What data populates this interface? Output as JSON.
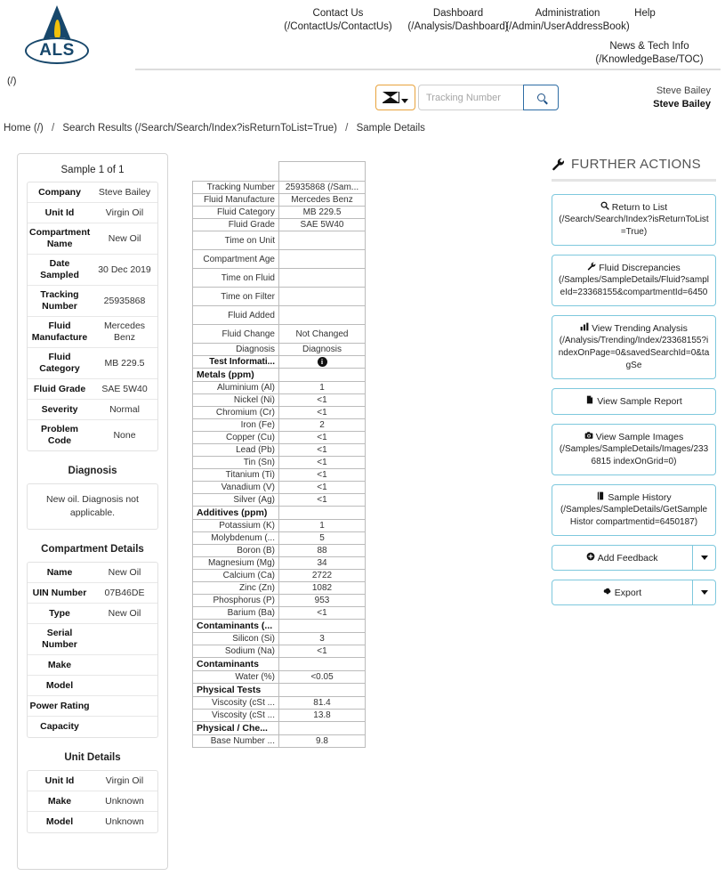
{
  "header": {
    "logo_text": "ALS",
    "nav": [
      {
        "label": "Contact Us",
        "url": "(/ContactUs/ContactUs)"
      },
      {
        "label": "Dashboard",
        "url": "(/Analysis/Dashboard)"
      },
      {
        "label": "Administration",
        "url": "(/Admin/UserAddressBook)"
      },
      {
        "label": "Help",
        "url": ""
      },
      {
        "label": "News & Tech Info",
        "url": "(/KnowledgeBase/TOC)"
      }
    ],
    "home_path": "(/)",
    "search": {
      "placeholder": "Tracking Number",
      "value": "",
      "env_icon": "envelope-icon",
      "search_icon": "search-icon"
    },
    "user": {
      "line1": "Steve Bailey",
      "line2": "Steve Bailey"
    }
  },
  "breadcrumb": {
    "items": [
      "Home (/)",
      "Search Results (/Search/Search/Index?isReturnToList=True)",
      "Sample Details"
    ],
    "separator": "/"
  },
  "left_panel": {
    "sample_count": "Sample 1 of 1",
    "summary_rows": [
      {
        "key": "Company",
        "value": "Steve Bailey"
      },
      {
        "key": "Unit Id",
        "value": "Virgin Oil"
      },
      {
        "key": "Compartment Name",
        "value": "New Oil"
      },
      {
        "key": "Date Sampled",
        "value": "30 Dec 2019"
      },
      {
        "key": "Tracking Number",
        "value": "25935868"
      },
      {
        "key": "Fluid Manufacture",
        "value": "Mercedes Benz"
      },
      {
        "key": "Fluid Category",
        "value": "MB 229.5"
      },
      {
        "key": "Fluid Grade",
        "value": "SAE 5W40"
      },
      {
        "key": "Severity",
        "value": "Normal"
      },
      {
        "key": "Problem Code",
        "value": "None"
      }
    ],
    "diagnosis_title": "Diagnosis",
    "diagnosis_text": "New oil. Diagnosis not applicable.",
    "compartment_title": "Compartment Details",
    "compartment_rows": [
      {
        "key": "Name",
        "value": "New Oil"
      },
      {
        "key": "UIN Number",
        "value": "07B46DE"
      },
      {
        "key": "Type",
        "value": "New Oil"
      },
      {
        "key": "Serial Number",
        "value": ""
      },
      {
        "key": "Make",
        "value": ""
      },
      {
        "key": "Model",
        "value": ""
      },
      {
        "key": "Power Rating",
        "value": ""
      },
      {
        "key": "Capacity",
        "value": ""
      }
    ],
    "unit_title": "Unit Details",
    "unit_rows": [
      {
        "key": "Unit Id",
        "value": "Virgin Oil"
      },
      {
        "key": "Make",
        "value": "Unknown"
      },
      {
        "key": "Model",
        "value": "Unknown"
      }
    ]
  },
  "center_table": {
    "header_value": "",
    "rows": [
      {
        "key": "Tracking Number",
        "value": "25935868 (/Sam...",
        "type": "normal"
      },
      {
        "key": "Fluid Manufacture",
        "value": "Mercedes Benz",
        "type": "normal"
      },
      {
        "key": "Fluid Category",
        "value": "MB 229.5",
        "type": "normal"
      },
      {
        "key": "Fluid Grade",
        "value": "SAE 5W40",
        "type": "normal"
      },
      {
        "key": "Time on Unit",
        "value": "",
        "type": "tall"
      },
      {
        "key": "Compartment Age",
        "value": "",
        "type": "tall"
      },
      {
        "key": "Time on Fluid",
        "value": "",
        "type": "tall"
      },
      {
        "key": "Time on Filter",
        "value": "",
        "type": "tall"
      },
      {
        "key": "Fluid Added",
        "value": "",
        "type": "tall"
      },
      {
        "key": "Fluid Change",
        "value": "Not Changed",
        "type": "tall"
      },
      {
        "key": "Diagnosis",
        "value": "Diagnosis",
        "type": "normal"
      },
      {
        "key": "Test Informati...",
        "value": "INFO_ICON",
        "type": "bold-k"
      },
      {
        "key": "Metals (ppm)",
        "value": "",
        "type": "group"
      },
      {
        "key": "Aluminium (Al)",
        "value": "1",
        "type": "normal"
      },
      {
        "key": "Nickel (Ni)",
        "value": "<1",
        "type": "normal"
      },
      {
        "key": "Chromium (Cr)",
        "value": "<1",
        "type": "normal"
      },
      {
        "key": "Iron (Fe)",
        "value": "2",
        "type": "normal"
      },
      {
        "key": "Copper (Cu)",
        "value": "<1",
        "type": "normal"
      },
      {
        "key": "Lead (Pb)",
        "value": "<1",
        "type": "normal"
      },
      {
        "key": "Tin (Sn)",
        "value": "<1",
        "type": "normal"
      },
      {
        "key": "Titanium (Ti)",
        "value": "<1",
        "type": "normal"
      },
      {
        "key": "Vanadium (V)",
        "value": "<1",
        "type": "normal"
      },
      {
        "key": "Silver (Ag)",
        "value": "<1",
        "type": "normal"
      },
      {
        "key": "Additives (ppm)",
        "value": "",
        "type": "group"
      },
      {
        "key": "Potassium (K)",
        "value": "1",
        "type": "normal"
      },
      {
        "key": "Molybdenum (...",
        "value": "5",
        "type": "normal"
      },
      {
        "key": "Boron (B)",
        "value": "88",
        "type": "normal"
      },
      {
        "key": "Magnesium (Mg)",
        "value": "34",
        "type": "normal"
      },
      {
        "key": "Calcium (Ca)",
        "value": "2722",
        "type": "normal"
      },
      {
        "key": "Zinc (Zn)",
        "value": "1082",
        "type": "normal"
      },
      {
        "key": "Phosphorus (P)",
        "value": "953",
        "type": "normal"
      },
      {
        "key": "Barium (Ba)",
        "value": "<1",
        "type": "normal"
      },
      {
        "key": "Contaminants (...",
        "value": "",
        "type": "group"
      },
      {
        "key": "Silicon (Si)",
        "value": "3",
        "type": "normal"
      },
      {
        "key": "Sodium (Na)",
        "value": "<1",
        "type": "normal"
      },
      {
        "key": "Contaminants",
        "value": "",
        "type": "group"
      },
      {
        "key": "Water (%)",
        "value": "<0.05",
        "type": "normal"
      },
      {
        "key": "Physical Tests",
        "value": "",
        "type": "group"
      },
      {
        "key": "Viscosity (cSt ...",
        "value": "81.4",
        "type": "normal"
      },
      {
        "key": "Viscosity (cSt ...",
        "value": "13.8",
        "type": "normal"
      },
      {
        "key": "Physical / Che...",
        "value": "",
        "type": "group"
      },
      {
        "key": "Base Number ...",
        "value": "9.8",
        "type": "normal"
      }
    ]
  },
  "further_actions": {
    "title": "FURTHER ACTIONS",
    "title_icon": "wrench-icon",
    "buttons": [
      {
        "icon": "search-icon",
        "icon_glyph": "⌕",
        "label": "Return to List",
        "url": "(/Search/Search/Index?isReturnToList=True)",
        "style": "plain"
      },
      {
        "icon": "wrench-icon",
        "icon_glyph": "⚒",
        "label": "Fluid Discrepancies",
        "url": "(/Samples/SampleDetails/Fluid?sampleId=23368155&compartmentId=6450",
        "style": "plain"
      },
      {
        "icon": "bar-chart-icon",
        "icon_glyph": "Ὄa",
        "label": "View Trending Analysis",
        "url": "(/Analysis/Trending/Index/23368155?indexOnPage=0&savedSearchId=0&tagSe",
        "style": "plain"
      },
      {
        "icon": "document-icon",
        "icon_glyph": "Ὄ4",
        "label": "View Sample Report",
        "url": "",
        "style": "plain"
      },
      {
        "icon": "camera-icon",
        "icon_glyph": "὏7",
        "label": "View Sample Images",
        "url": "(/Samples/SampleDetails/Images/2336815 indexOnGrid=0)",
        "style": "plain"
      },
      {
        "icon": "book-icon",
        "icon_glyph": "Ὅ3",
        "label": "Sample History",
        "url": "(/Samples/SampleDetails/GetSampleHistor compartmentid=6450187)",
        "style": "plain"
      }
    ],
    "split_buttons": [
      {
        "icon": "plus-circle-icon",
        "label": "Add Feedback"
      },
      {
        "icon": "cloud-download-icon",
        "label": "Export"
      }
    ]
  },
  "colors": {
    "brand_navy": "#17476b",
    "brand_flame": "#f2c10a",
    "accent_orange": "#e8a33d",
    "button_border": "#7ec8dd",
    "table_border": "#bbbbbb"
  }
}
